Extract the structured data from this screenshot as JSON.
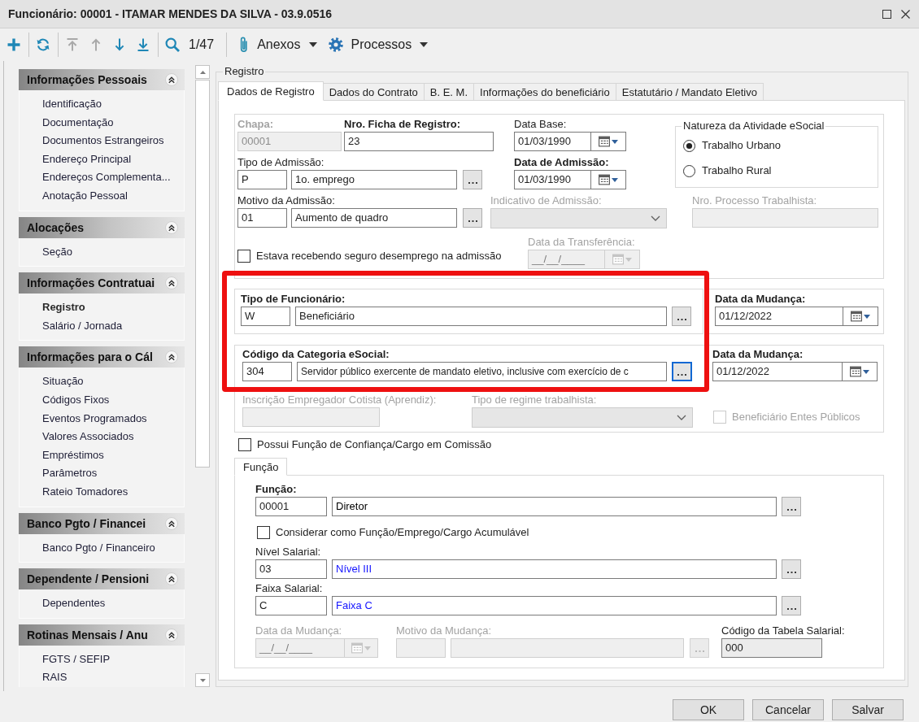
{
  "window": {
    "title": "Funcionário: 00001 - ITAMAR MENDES DA SILVA - 03.9.0516"
  },
  "toolbar": {
    "button_groups": [
      [
        {
          "kind": "add",
          "disabled": false
        }
      ],
      [
        {
          "kind": "refresh",
          "disabled": false
        }
      ],
      [
        {
          "kind": "first",
          "disabled": true
        },
        {
          "kind": "previous",
          "disabled": true
        },
        {
          "kind": "next",
          "disabled": false
        },
        {
          "kind": "last",
          "disabled": false
        }
      ],
      [
        {
          "kind": "search",
          "disabled": false
        }
      ]
    ],
    "record_position": "1/47",
    "menus": [
      {
        "kind": "attachments",
        "label": "Anexos"
      },
      {
        "kind": "processes",
        "label": "Processos"
      }
    ]
  },
  "sidebar": {
    "sections": [
      {
        "title": "Informações Pessoais",
        "expanded": true,
        "items": [
          {
            "label": "Identificação",
            "selected": false
          },
          {
            "label": "Documentação",
            "selected": false
          },
          {
            "label": "Documentos Estrangeiros",
            "selected": false
          },
          {
            "label": "Endereço Principal",
            "selected": false
          },
          {
            "label": "Endereços Complementa...",
            "selected": false
          },
          {
            "label": "Anotação Pessoal",
            "selected": false
          }
        ]
      },
      {
        "title": "Alocações",
        "expanded": true,
        "items": [
          {
            "label": "Seção",
            "selected": false
          }
        ]
      },
      {
        "title": "Informações Contratuai",
        "expanded": true,
        "items": [
          {
            "label": "Registro",
            "selected": true
          },
          {
            "label": "Salário / Jornada",
            "selected": false
          }
        ]
      },
      {
        "title": "Informações para o Cál",
        "expanded": true,
        "items": [
          {
            "label": "Situação",
            "selected": false
          },
          {
            "label": "Códigos Fixos",
            "selected": false
          },
          {
            "label": "Eventos Programados",
            "selected": false
          },
          {
            "label": "Valores Associados",
            "selected": false
          },
          {
            "label": "Empréstimos",
            "selected": false
          },
          {
            "label": "Parâmetros",
            "selected": false
          },
          {
            "label": "Rateio Tomadores",
            "selected": false
          }
        ]
      },
      {
        "title": "Banco Pgto / Financei",
        "expanded": true,
        "items": [
          {
            "label": "Banco Pgto / Financeiro",
            "selected": false
          }
        ]
      },
      {
        "title": "Dependente / Pensioni",
        "expanded": true,
        "items": [
          {
            "label": "Dependentes",
            "selected": false
          }
        ]
      },
      {
        "title": "Rotinas Mensais / Anu",
        "expanded": true,
        "items": [
          {
            "label": "FGTS / SEFIP",
            "selected": false
          },
          {
            "label": "RAIS",
            "selected": false
          }
        ]
      }
    ]
  },
  "registro": {
    "label": "Registro",
    "tabs": [
      {
        "label": "Dados de Registro",
        "selected": true
      },
      {
        "label": "Dados do Contrato",
        "selected": false
      },
      {
        "label": "B. E. M.",
        "selected": false
      },
      {
        "label": "Informações do beneficiário",
        "selected": false
      },
      {
        "label": "Estatutário / Mandato Eletivo",
        "selected": false
      }
    ],
    "chapa": {
      "label": "Chapa:",
      "value": "00001",
      "required": true,
      "disabled": true
    },
    "ficha_registro": {
      "label": "Nro. Ficha de Registro:",
      "value": "23",
      "required": true
    },
    "data_base": {
      "label": "Data Base:",
      "value": "01/03/1990"
    },
    "tipo_admissao": {
      "label": "Tipo de Admissão:",
      "code": "P",
      "description": "1o. emprego"
    },
    "data_admissao": {
      "label": "Data de Admissão:",
      "value": "01/03/1990",
      "required": true
    },
    "motivo_admissao": {
      "label": "Motivo da Admissão:",
      "code": "01",
      "description": "Aumento de quadro"
    },
    "indicativo_admissao": {
      "label": "Indicativo de Admissão:",
      "disabled": true
    },
    "natureza_atividade": {
      "title": "Natureza da Atividade eSocial",
      "options": [
        {
          "label": "Trabalho Urbano",
          "selected": true
        },
        {
          "label": "Trabalho Rural",
          "selected": false
        }
      ]
    },
    "nro_processo": {
      "label": "Nro. Processo Trabalhista:",
      "disabled": true
    },
    "seguro_desemprego": {
      "label": "Estava recebendo seguro desemprego na admissão",
      "checked": false
    },
    "data_transferencia": {
      "label": "Data da Transferência:",
      "placeholder": "__/__/____",
      "disabled": true
    },
    "classification": {
      "highlighted": true,
      "tipo_funcionario": {
        "label": "Tipo de Funcionário:",
        "code": "W",
        "description": "Beneficiário",
        "required": true,
        "focused": false
      },
      "tipo_data_mudanca": {
        "label": "Data da Mudança:",
        "value": "01/12/2022",
        "required": true
      },
      "categoria": {
        "label": "Código da Categoria eSocial:",
        "code": "304",
        "description": "Servidor público exercente de mandato eletivo, inclusive com exercício de c",
        "required": true,
        "focused": true
      },
      "categoria_data_mudanca": {
        "label": "Data da Mudança:",
        "value": "01/12/2022",
        "required": true
      }
    },
    "inscricao_cotista": {
      "label": "Inscrição Empregador Cotista (Aprendiz):",
      "disabled": true
    },
    "tipo_regime": {
      "label": "Tipo de regime trabalhista:",
      "disabled": true
    },
    "beneficiario_entes": {
      "label": "Beneficiário Entes Públicos",
      "checked": false,
      "disabled": true
    },
    "funcao_confianca": {
      "label": "Possui Função de Confiança/Cargo em Comissão",
      "checked": false
    },
    "funcao_tabs": [
      {
        "label": "Função",
        "selected": true
      }
    ],
    "funcao": {
      "rows": [
        {
          "kind": "lookup",
          "label": "Função:",
          "code": "00001",
          "description": "Diretor",
          "required": true,
          "color": "#000000"
        },
        {
          "kind": "checkbox",
          "label": "Considerar como Função/Emprego/Cargo Acumulável",
          "checked": false
        },
        {
          "kind": "lookup",
          "label": "Nível Salarial:",
          "code": "03",
          "description": "Nível III",
          "color": "#1414ff"
        },
        {
          "kind": "lookup",
          "label": "Faixa Salarial:",
          "code": "C",
          "description": "Faixa C",
          "color": "#1414ff"
        }
      ],
      "data_mudanca": {
        "label": "Data da Mudança:",
        "placeholder": "__/__/____",
        "disabled": true
      },
      "motivo_mudanca": {
        "label": "Motivo da Mudança:",
        "disabled": true
      },
      "tabela_salarial": {
        "label": "Código da Tabela Salarial:",
        "value": "000",
        "readonly": true
      }
    }
  },
  "buttons": [
    "OK",
    "Cancelar",
    "Salvar"
  ]
}
